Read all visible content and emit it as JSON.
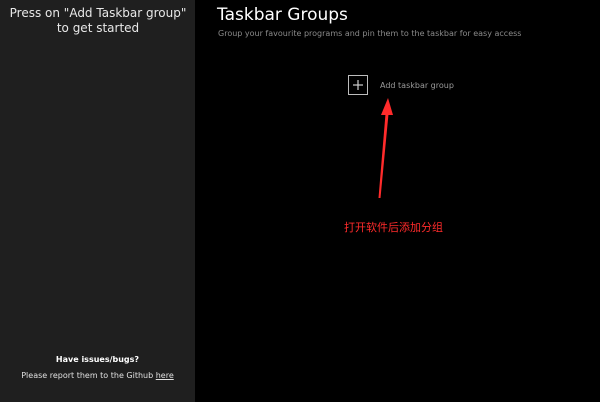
{
  "sidebar": {
    "prompt": "Press on \"Add Taskbar group\" to get started",
    "issues_title": "Have issues/bugs?",
    "issues_text": "Please report them to the Github",
    "issues_link": "here"
  },
  "main": {
    "title": "Taskbar Groups",
    "subtitle": "Group your favourite programs and pin them to the taskbar for easy access",
    "add_group_label": "Add taskbar group",
    "annotation": "打开软件后添加分组"
  },
  "colors": {
    "sidebar_bg": "#1f1f1f",
    "main_bg": "#000000",
    "annotation": "#ff2b2b"
  },
  "icons": {
    "add": "plus-icon",
    "annotation_arrow": "arrow-up-icon"
  }
}
